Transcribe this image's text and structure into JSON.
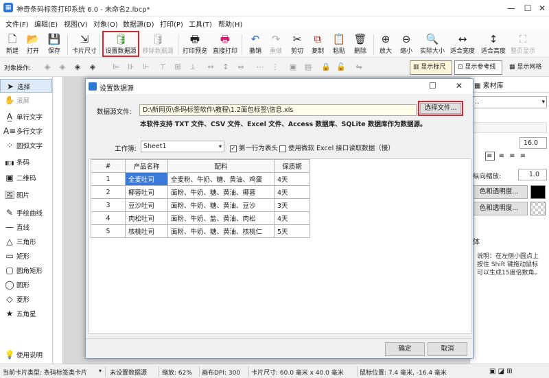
{
  "window": {
    "title": "神奇条码标签打印系统 6.0 - 未命名2.lbcp*",
    "minimize": "—",
    "maximize": "☐",
    "close": "✕"
  },
  "menu": [
    "文件(F)",
    "编辑(E)",
    "视图(V)",
    "对象(O)",
    "数据源(D)",
    "打印(P)",
    "工具(T)",
    "帮助(H)"
  ],
  "toolbar": [
    {
      "label": "新建",
      "icon": "new-icon",
      "glyph": "🗋"
    },
    {
      "label": "打开",
      "icon": "open-icon",
      "glyph": "📂"
    },
    {
      "label": "保存",
      "icon": "save-icon",
      "glyph": "💾"
    },
    {
      "label": "卡片尺寸",
      "icon": "card-size-icon",
      "glyph": "⇲"
    },
    {
      "label": "设置数据源",
      "icon": "database-icon",
      "glyph": "🛢"
    },
    {
      "label": "移除数据源",
      "icon": "remove-database-icon",
      "glyph": "🛢"
    },
    {
      "label": "打印预览",
      "icon": "print-preview-icon",
      "glyph": "🖶"
    },
    {
      "label": "直接打印",
      "icon": "print-icon",
      "glyph": "🖶"
    },
    {
      "label": "撤销",
      "icon": "undo-icon",
      "glyph": "↶"
    },
    {
      "label": "重做",
      "icon": "redo-icon",
      "glyph": "↷"
    },
    {
      "label": "剪切",
      "icon": "cut-icon",
      "glyph": "✂"
    },
    {
      "label": "复制",
      "icon": "copy-icon",
      "glyph": "⧉"
    },
    {
      "label": "粘贴",
      "icon": "paste-icon",
      "glyph": "📋"
    },
    {
      "label": "删除",
      "icon": "delete-icon",
      "glyph": "🗑"
    },
    {
      "label": "放大",
      "icon": "zoom-in-icon",
      "glyph": "⊕"
    },
    {
      "label": "缩小",
      "icon": "zoom-out-icon",
      "glyph": "⊖"
    },
    {
      "label": "实际大小",
      "icon": "actual-size-icon",
      "glyph": "🔍"
    },
    {
      "label": "适合宽度",
      "icon": "fit-width-icon",
      "glyph": "↔"
    },
    {
      "label": "适合高度",
      "icon": "fit-height-icon",
      "glyph": "↕"
    },
    {
      "label": "整页显示",
      "icon": "fit-page-icon",
      "glyph": "⛶"
    }
  ],
  "objbar": {
    "label": "对象操作:",
    "ruler": "显示标尺",
    "guides": "显示参考线",
    "grid": "显示网格"
  },
  "tools": [
    {
      "label": "选择",
      "glyph": "➤"
    },
    {
      "label": "滚屏",
      "glyph": "✋"
    },
    {
      "label": "单行文字",
      "glyph": "A̲"
    },
    {
      "label": "多行文字",
      "glyph": "A≡"
    },
    {
      "label": "圆弧文字",
      "glyph": "⁘"
    },
    {
      "label": "条码",
      "glyph": "▮▯▮"
    },
    {
      "label": "二维码",
      "glyph": "▣"
    },
    {
      "label": "图片",
      "glyph": "🖼"
    },
    {
      "label": "手绘曲线",
      "glyph": "✎"
    },
    {
      "label": "直线",
      "glyph": "—"
    },
    {
      "label": "三角形",
      "glyph": "△"
    },
    {
      "label": "矩形",
      "glyph": "▭"
    },
    {
      "label": "圆角矩形",
      "glyph": "▢"
    },
    {
      "label": "圆形",
      "glyph": "◯"
    },
    {
      "label": "菱形",
      "glyph": "◇"
    },
    {
      "label": "五角星",
      "glyph": "★"
    },
    {
      "label": "使用说明",
      "glyph": "💡"
    }
  ],
  "right": {
    "tab_material": "素材库",
    "font_size": "16.0",
    "scale_label": "纵向缩放:",
    "scale": "1.0",
    "color1": "色和透明度...",
    "color2": "色和透明度...",
    "section": "体",
    "tip": "说明：在左侧小圆点上按住 Shift 键拖动鼠标可以生成15度倍数角。"
  },
  "status": {
    "card_type": "当前卡片类型: 条码标签类卡片",
    "datasource": "未设置数据源",
    "zoom": "缩放: 62%",
    "dpi": "画布DPI: 300",
    "size": "卡片尺寸: 60.0 毫米 x 40.0 毫米",
    "mouse": "鼠标位置: 7.4 毫米, -16.4 毫米"
  },
  "dialog": {
    "title": "设置数据源",
    "file_label": "数据源文件:",
    "file_path": "D:\\新网页\\条码标签软件\\教程\\1.2面包标签\\信息.xls",
    "choose_button": "选择文件...",
    "support_note": "本软件支持 TXT 文件、CSV 文件、Excel 文件、Access 数据库、SQLite 数据库作为数据源。",
    "sheet_label": "工作簿:",
    "sheet_value": "Sheet1",
    "first_row_header": "第一行为表头",
    "use_excel_interface": "使用微软 Excel 接口读取数据（慢）",
    "columns": [
      "#",
      "产品名称",
      "配料",
      "保质期"
    ],
    "rows": [
      [
        "1",
        "全麦吐司",
        "全麦粉、牛奶、糖、黄油、鸡蛋",
        "4天"
      ],
      [
        "2",
        "椰蓉吐司",
        "面粉、牛奶、糖、黄油、椰蓉",
        "4天"
      ],
      [
        "3",
        "豆沙吐司",
        "面粉、牛奶、糖、黄油、豆沙",
        "3天"
      ],
      [
        "4",
        "肉松吐司",
        "面粉、牛奶、盐、黄油、肉松",
        "4天"
      ],
      [
        "5",
        "核桃吐司",
        "面粉、牛奶、糖、黄油、核桃仁",
        "5天"
      ]
    ],
    "ok": "确定",
    "cancel": "取消"
  },
  "colors": {
    "highlight": "#e0202e",
    "selection": "#3a7ad8"
  }
}
